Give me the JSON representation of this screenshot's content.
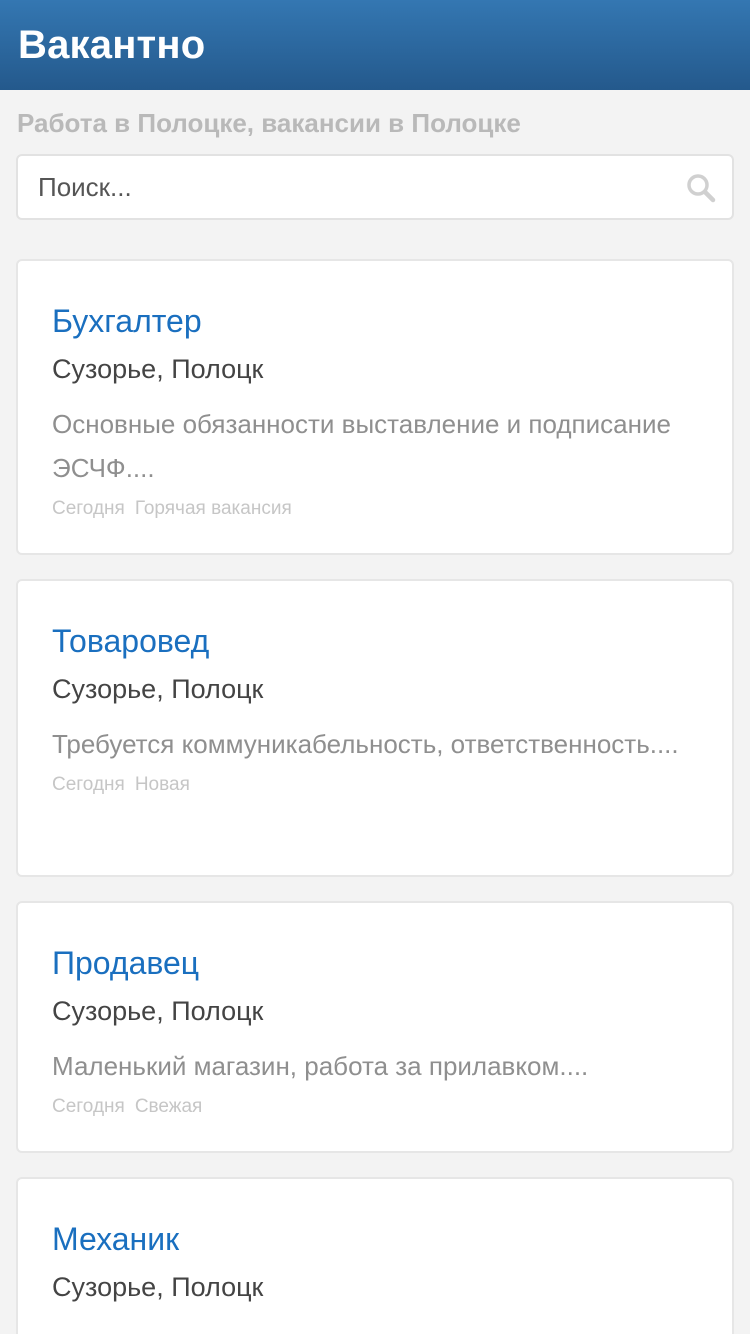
{
  "header": {
    "title": "Вакантно"
  },
  "subtitle": "Работа в Полоцке, вакансии в Полоцке",
  "search": {
    "placeholder": "Поиск..."
  },
  "vacancies": [
    {
      "title": "Бухгалтер",
      "location": "Сузорье, Полоцк",
      "description": "Основные обязанности выставление и подписание ЭСЧФ....",
      "date": "Сегодня",
      "tag": "Горячая вакансия"
    },
    {
      "title": "Товаровед",
      "location": "Сузорье, Полоцк",
      "description": "Требуется коммуникабельность, ответственность....",
      "date": "Сегодня",
      "tag": "Новая"
    },
    {
      "title": "Продавец",
      "location": "Сузорье, Полоцк",
      "description": "Маленький магазин, работа за прилавком....",
      "date": "Сегодня",
      "tag": "Свежая"
    },
    {
      "title": "Механик",
      "location": "Сузорье, Полоцк"
    }
  ],
  "colors": {
    "header_bg": "#2c6aa3",
    "link": "#1a6fbf",
    "background": "#f3f3f3"
  },
  "icons": {
    "search": "search-icon"
  }
}
